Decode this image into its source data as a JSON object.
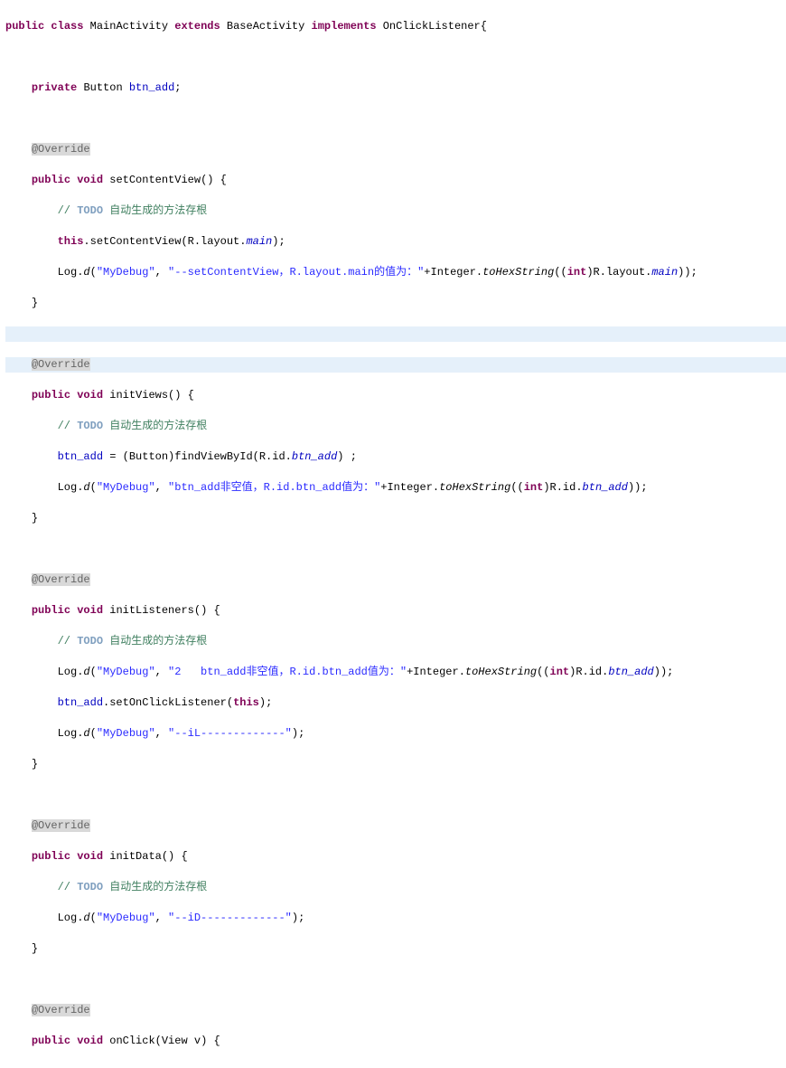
{
  "header": {
    "kw_public": "public",
    "kw_class": "class",
    "classname": "MainActivity",
    "kw_extends": "extends",
    "base": "BaseActivity",
    "kw_implements": "implements",
    "iface": "OnClickListener",
    "brace": "{"
  },
  "fld": {
    "kw_private": "private",
    "type": "Button",
    "name": "btn_add",
    "semi": ";"
  },
  "ov": "@Override",
  "m1": {
    "sig_kw1": "public",
    "sig_kw2": "void",
    "name": "setContentView() {",
    "c1a": "// ",
    "c1b": "TODO",
    "c1c": " 自动生成的方法存根",
    "l1a": "this",
    "l1b": ".setContentView(R.layout.",
    "l1c": "main",
    "l1d": ");",
    "l2a": "Log.",
    "l2b": "d",
    "l2c": "(",
    "l2d": "\"MyDebug\"",
    "l2e": ", ",
    "l2f": "\"--setContentView，R.layout.main的值为：\"",
    "l2g": "+Integer.",
    "l2h": "toHexString",
    "l2i": "((",
    "l2j": "int",
    "l2k": ")R.layout.",
    "l2l": "main",
    "l2m": "));",
    "close": "}"
  },
  "m2": {
    "sig_kw1": "public",
    "sig_kw2": "void",
    "name": "initViews() {",
    "c1a": "// ",
    "c1b": "TODO",
    "c1c": " 自动生成的方法存根",
    "l1a": "btn_add",
    "l1b": " = (Button)findViewById(R.id.",
    "l1c": "btn_add",
    "l1d": ") ;",
    "l2a": "Log.",
    "l2b": "d",
    "l2c": "(",
    "l2d": "\"MyDebug\"",
    "l2e": ", ",
    "l2f": "\"btn_add非空值，R.id.btn_add值为：\"",
    "l2g": "+Integer.",
    "l2h": "toHexString",
    "l2i": "((",
    "l2j": "int",
    "l2k": ")R.id.",
    "l2l": "btn_add",
    "l2m": "));",
    "close": "}"
  },
  "m3": {
    "sig_kw1": "public",
    "sig_kw2": "void",
    "name": "initListeners() {",
    "c1a": "// ",
    "c1b": "TODO",
    "c1c": " 自动生成的方法存根",
    "l1a": "Log.",
    "l1b": "d",
    "l1c": "(",
    "l1d": "\"MyDebug\"",
    "l1e": ", ",
    "l1f": "\"2   btn_add非空值，R.id.btn_add值为：\"",
    "l1g": "+Integer.",
    "l1h": "toHexString",
    "l1i": "((",
    "l1j": "int",
    "l1k": ")R.id.",
    "l1l": "btn_add",
    "l1m": "));",
    "l2a": "btn_add",
    "l2b": ".setOnClickListener(",
    "l2c": "this",
    "l2d": ");",
    "l3a": "Log.",
    "l3b": "d",
    "l3c": "(",
    "l3d": "\"MyDebug\"",
    "l3e": ", ",
    "l3f": "\"--iL-------------\"",
    "l3g": ");",
    "close": "}"
  },
  "m4": {
    "sig_kw1": "public",
    "sig_kw2": "void",
    "name": "initData() {",
    "c1a": "// ",
    "c1b": "TODO",
    "c1c": " 自动生成的方法存根",
    "l1a": "Log.",
    "l1b": "d",
    "l1c": "(",
    "l1d": "\"MyDebug\"",
    "l1e": ", ",
    "l1f": "\"--iD-------------\"",
    "l1g": ");",
    "close": "}"
  },
  "m5": {
    "sig_kw1": "public",
    "sig_kw2": "void",
    "name": "onClick(View v) {"
  }
}
